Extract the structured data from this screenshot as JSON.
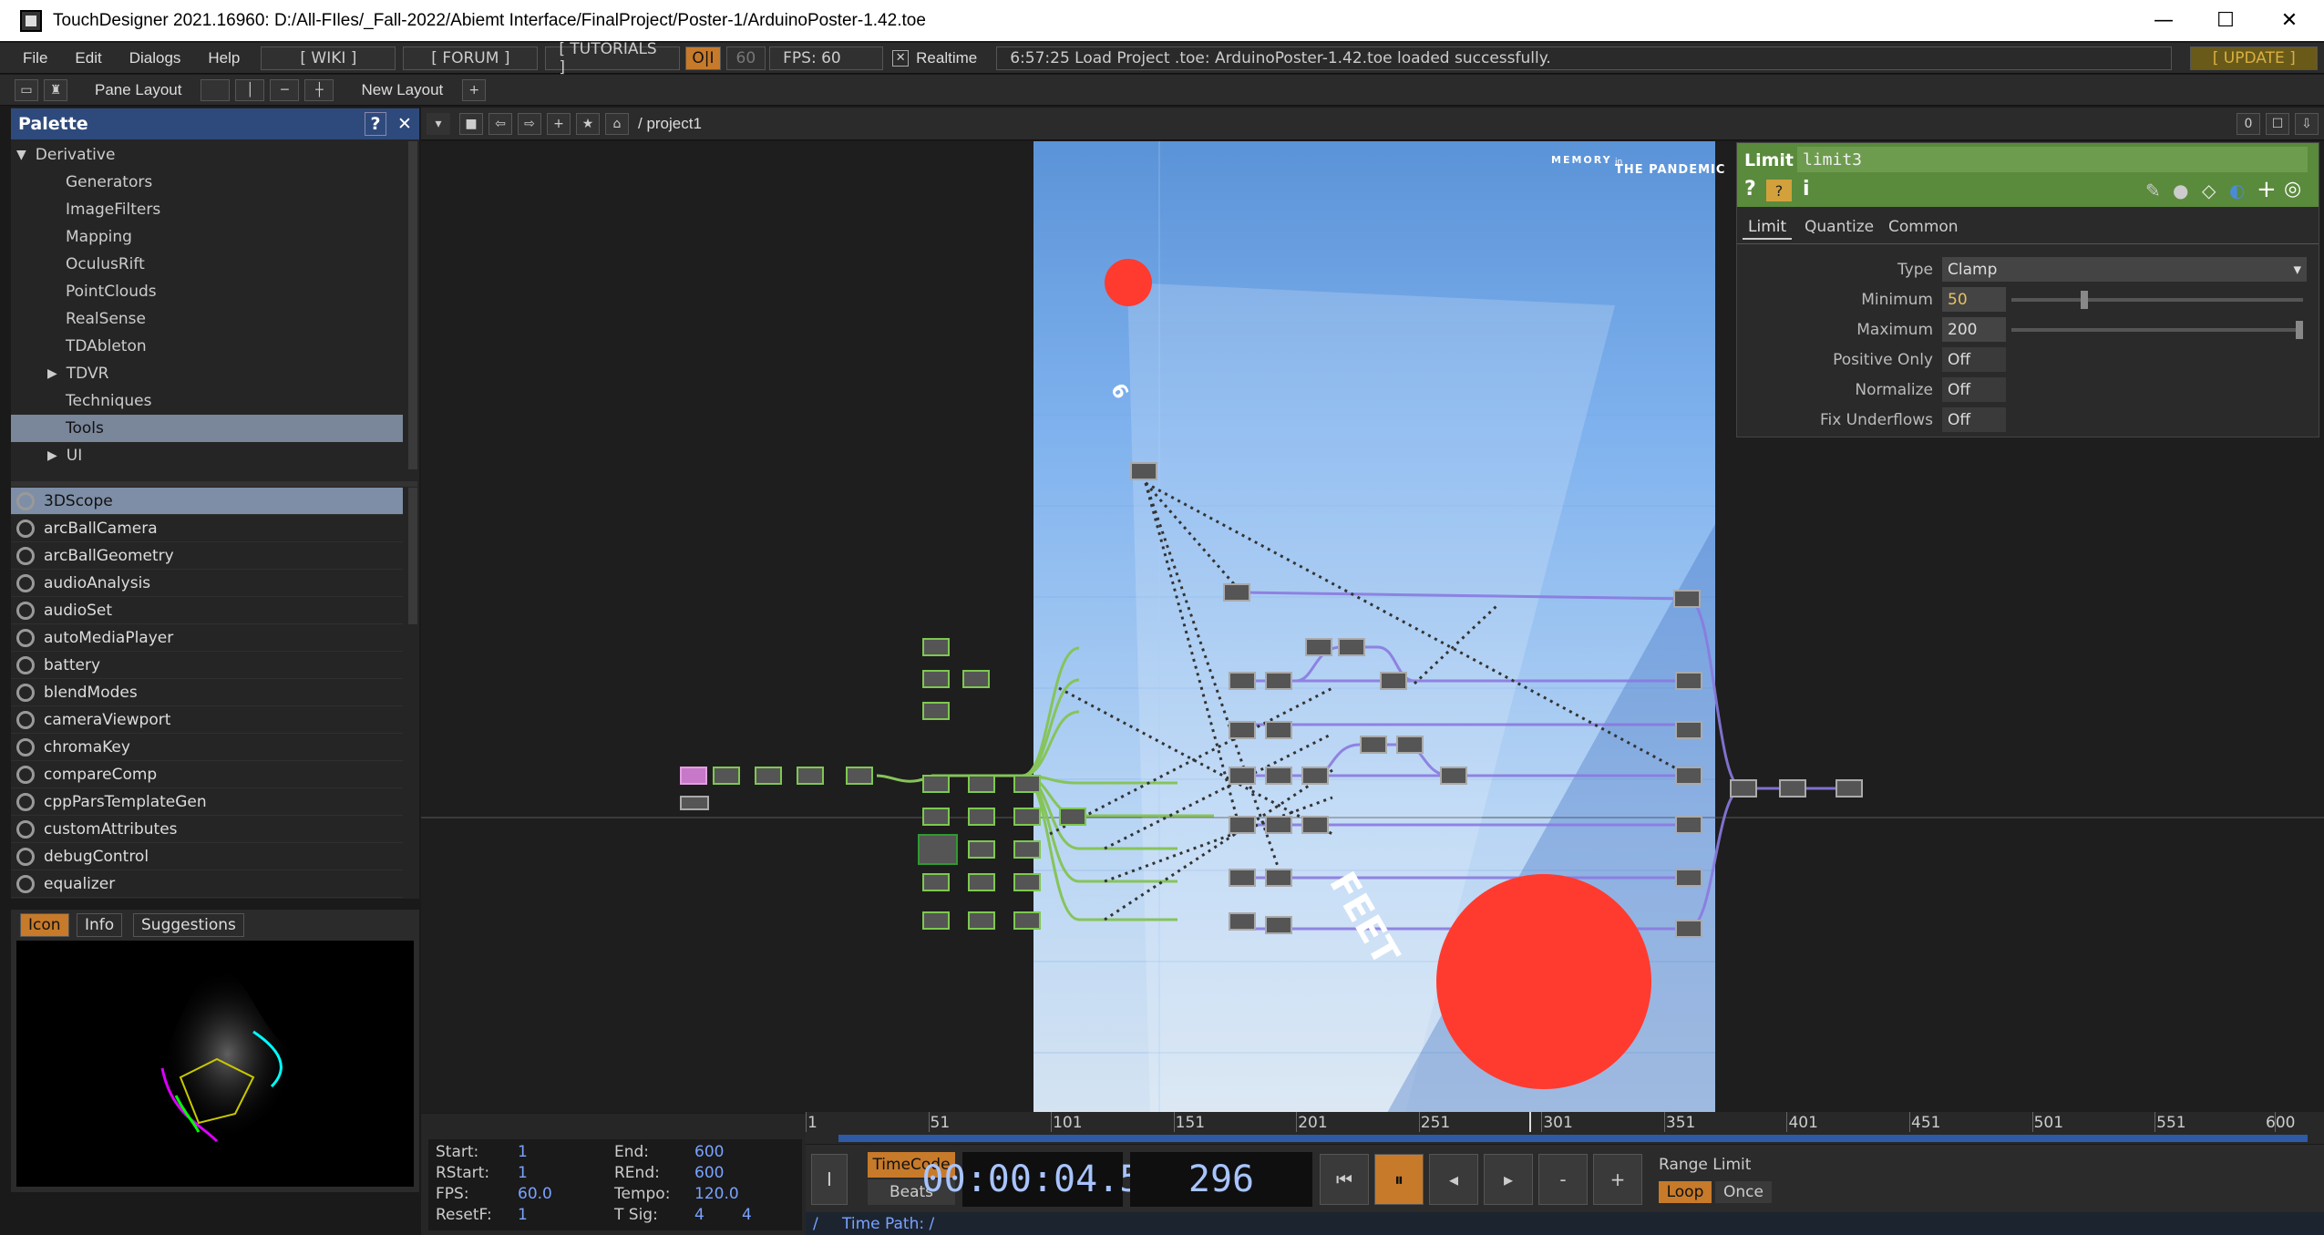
{
  "window": {
    "title": "TouchDesigner 2021.16960: D:/All-FIles/_Fall-2022/Abiemt Interface/FinalProject/Poster-1/ArduinoPoster-1.42.toe",
    "minimize": "—",
    "maximize": "☐",
    "close": "✕"
  },
  "menu": {
    "items": [
      "File",
      "Edit",
      "Dialogs",
      "Help"
    ],
    "wiki": "[ WIKI ]",
    "forum": "[ FORUM ]",
    "tutorials": "[ TUTORIALS ]",
    "oi": "O|I",
    "fps_target": "60",
    "fps_label": "FPS:  60",
    "realtime": "Realtime",
    "status": "6:57:25 Load Project .toe: ArduinoPoster-1.42.toe loaded successfully.",
    "update": "[ UPDATE ]"
  },
  "toolbar": {
    "pane_layout": "Pane Layout",
    "new_layout": "New Layout"
  },
  "palette": {
    "title": "Palette",
    "help": "?",
    "close": "✕",
    "tree": [
      {
        "label": "Derivative",
        "expanded": true
      },
      {
        "label": "Generators"
      },
      {
        "label": "ImageFilters"
      },
      {
        "label": "Mapping"
      },
      {
        "label": "OculusRift"
      },
      {
        "label": "PointClouds"
      },
      {
        "label": "RealSense"
      },
      {
        "label": "TDAbleton"
      },
      {
        "label": "TDVR",
        "collapsed": true
      },
      {
        "label": "Techniques"
      },
      {
        "label": "Tools",
        "selected": true
      },
      {
        "label": "UI",
        "collapsed": true
      }
    ],
    "components": [
      "3DScope",
      "arcBallCamera",
      "arcBallGeometry",
      "audioAnalysis",
      "audioSet",
      "autoMediaPlayer",
      "battery",
      "blendModes",
      "cameraViewport",
      "chromaKey",
      "compareComp",
      "cppParsTemplateGen",
      "customAttributes",
      "debugControl",
      "equalizer"
    ],
    "tabs": [
      "Icon",
      "Info",
      "Suggestions"
    ]
  },
  "network": {
    "path": "/ project1",
    "right_counter": "0",
    "poster_brand_left": "MEMORY",
    "poster_brand_mid": "in",
    "poster_brand_right": "THE PANDEMIC",
    "poster_text_6": "6",
    "poster_text_feet": "FEET"
  },
  "params": {
    "op_type": "Limit",
    "op_name": "limit3",
    "tabs": [
      "Limit",
      "Quantize",
      "Common"
    ],
    "rows": [
      {
        "label": "Type",
        "value": "Clamp"
      },
      {
        "label": "Minimum",
        "value": "50"
      },
      {
        "label": "Maximum",
        "value": "200"
      },
      {
        "label": "Positive Only",
        "value": "Off"
      },
      {
        "label": "Normalize",
        "value": "Off"
      },
      {
        "label": "Fix Underflows",
        "value": "Off"
      }
    ],
    "slider_min": 0.25,
    "slider_max": 1.0
  },
  "timeline": {
    "ticks": [
      "1",
      "51",
      "101",
      "151",
      "201",
      "251",
      "301",
      "351",
      "401",
      "451",
      "501",
      "551",
      "600"
    ],
    "current_frame": 296
  },
  "range": {
    "start_label": "Start:",
    "start": "1",
    "end_label": "End:",
    "end": "600",
    "rstart_label": "RStart:",
    "rstart": "1",
    "rend_label": "REnd:",
    "rend": "600",
    "fps_label": "FPS:",
    "fps": "60.0",
    "tempo_label": "Tempo:",
    "tempo": "120.0",
    "resetf_label": "ResetF:",
    "resetf": "1",
    "tsig_label": "T Sig:",
    "tsig_a": "4",
    "tsig_b": "4"
  },
  "transport": {
    "timecode": "TimeCode",
    "beats": "Beats",
    "time": "00:00:04.55",
    "frame": "296",
    "range_limit": "Range Limit",
    "loop": "Loop",
    "once": "Once"
  },
  "timepath": {
    "slash": "/",
    "label": "Time Path: /"
  },
  "colors": {
    "accent_orange": "#c77a2a",
    "palette_header": "#2e4a7c",
    "param_header": "#5a8a3c",
    "poster_red": "#ff3b2f"
  }
}
